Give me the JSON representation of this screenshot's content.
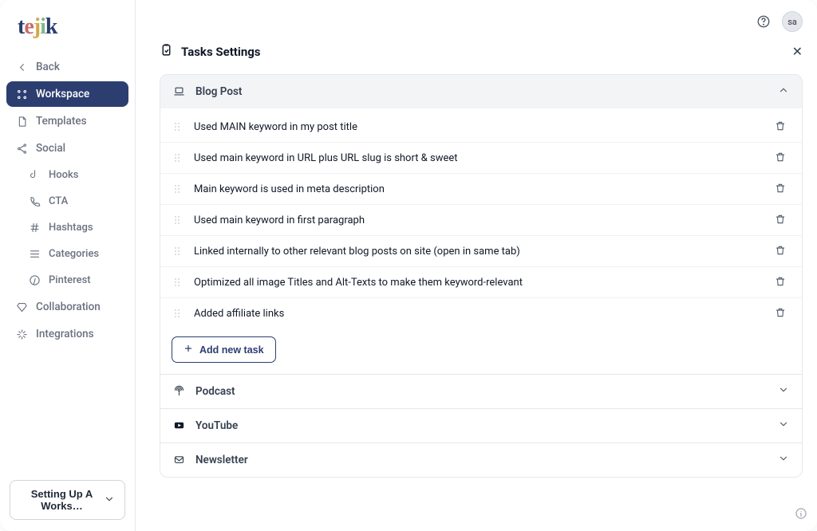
{
  "brand": {
    "t": "t",
    "e": "e",
    "j": "j",
    "i": "i",
    "k": "k"
  },
  "sidebar": {
    "back": "Back",
    "items": [
      {
        "label": "Workspace"
      },
      {
        "label": "Templates"
      },
      {
        "label": "Social"
      },
      {
        "label": "Hooks"
      },
      {
        "label": "CTA"
      },
      {
        "label": "Hashtags"
      },
      {
        "label": "Categories"
      },
      {
        "label": "Pinterest"
      },
      {
        "label": "Collaboration"
      },
      {
        "label": "Integrations"
      }
    ],
    "footer_label": "Setting Up A Works…"
  },
  "topbar": {
    "avatar": "sa"
  },
  "page": {
    "title": "Tasks Settings",
    "sections": {
      "blog": {
        "label": "Blog Post",
        "tasks": [
          "Used MAIN keyword in my post title",
          "Used main keyword in URL plus URL slug is short & sweet",
          "Main keyword is used in meta description",
          "Used main keyword in first paragraph",
          "Linked internally to other relevant blog posts on site (open in same tab)",
          "Optimized all image Titles and Alt-Texts to make them keyword-relevant",
          "Added affiliate links"
        ],
        "add_label": "Add new task"
      },
      "podcast": {
        "label": "Podcast"
      },
      "youtube": {
        "label": "YouTube"
      },
      "newsletter": {
        "label": "Newsletter"
      }
    }
  }
}
